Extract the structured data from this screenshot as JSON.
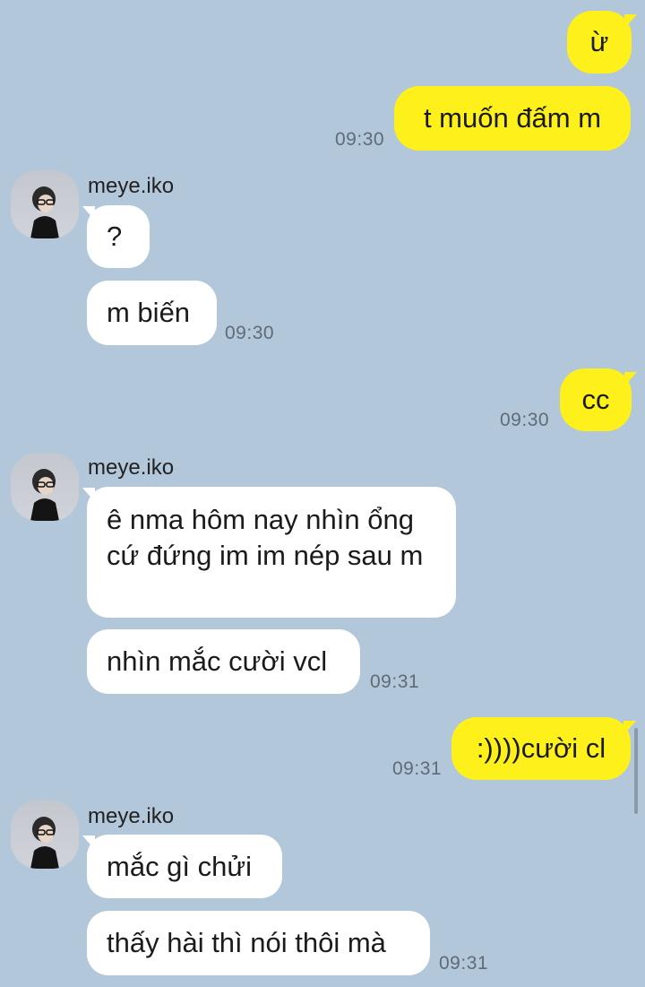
{
  "contact": {
    "name": "meye.iko"
  },
  "colors": {
    "background": "#b2c7da",
    "outgoing_bubble": "#fef01b",
    "incoming_bubble": "#ffffff",
    "timestamp": "#5f6b77"
  },
  "messages": [
    {
      "direction": "out",
      "text": "ừ",
      "time": ""
    },
    {
      "direction": "out",
      "text": "t muốn đấm m",
      "time": "09:30"
    },
    {
      "direction": "in",
      "sender": "meye.iko",
      "text": "?",
      "time": ""
    },
    {
      "direction": "in",
      "text": "m biến",
      "time": "09:30"
    },
    {
      "direction": "out",
      "text": "cc",
      "time": "09:30"
    },
    {
      "direction": "in",
      "sender": "meye.iko",
      "text": "ê nma hôm nay nhìn ổng cứ đứng im im nép sau m",
      "time": ""
    },
    {
      "direction": "in",
      "text": "nhìn mắc cười vcl",
      "time": "09:31"
    },
    {
      "direction": "out",
      "text": ":))))cười cl",
      "time": "09:31"
    },
    {
      "direction": "in",
      "sender": "meye.iko",
      "text": "mắc gì chửi",
      "time": ""
    },
    {
      "direction": "in",
      "text": "thấy hài thì nói thôi mà",
      "time": "09:31"
    }
  ]
}
